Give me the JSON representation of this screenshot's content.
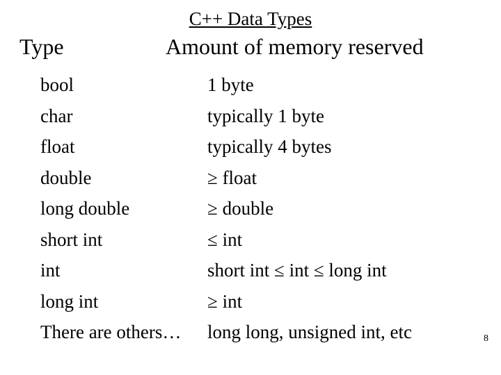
{
  "title": "C++ Data Types",
  "headers": {
    "type": "Type",
    "memory": "Amount of memory reserved"
  },
  "rows": [
    {
      "type": "bool",
      "mem": "1 byte"
    },
    {
      "type": "char",
      "mem": "typically 1 byte"
    },
    {
      "type": "float",
      "mem": "typically 4 bytes"
    },
    {
      "type": "double",
      "mem": " ≥ float"
    },
    {
      "type": "long double",
      "mem": " ≥ double"
    },
    {
      "type": "short int",
      "mem": "≤ int"
    },
    {
      "type": "int",
      "mem": "short int ≤ int ≤ long int"
    },
    {
      "type": "long int",
      "mem": " ≥ int"
    },
    {
      "type": "There are others…",
      "mem": "long long, unsigned int, etc"
    }
  ],
  "page_number": "8"
}
